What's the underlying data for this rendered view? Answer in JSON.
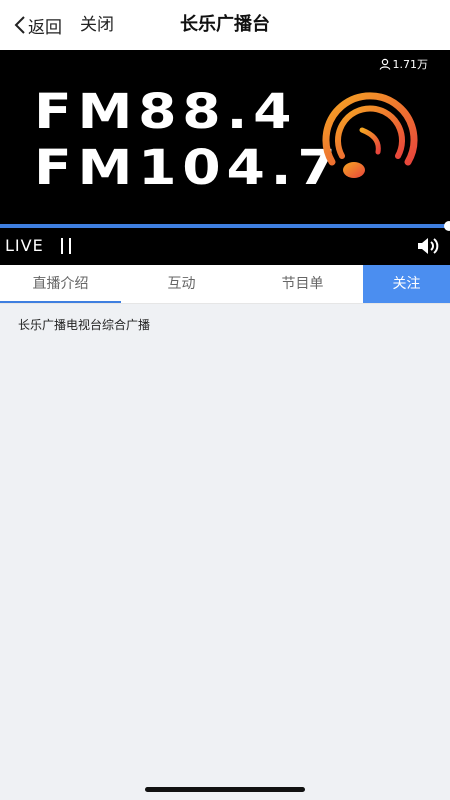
{
  "header": {
    "back_label": "返回",
    "close_label": "关闭",
    "title": "长乐广播台"
  },
  "player": {
    "listener_count": "1.71万",
    "banner_line1": "FM88.4",
    "banner_line2": "FM104.7",
    "live_label": "LIVE",
    "progress_fraction": 1.0
  },
  "tabs": [
    {
      "label": "直播介绍",
      "active": true
    },
    {
      "label": "互动",
      "active": false
    },
    {
      "label": "节目单",
      "active": false
    }
  ],
  "follow_label": "关注",
  "content": {
    "description": "长乐广播电视台综合广播"
  },
  "colors": {
    "accent": "#3f7fe0",
    "follow_bg": "#4b8ef0",
    "logo_gradient_start": "#f5a623",
    "logo_gradient_end": "#e8453c"
  }
}
